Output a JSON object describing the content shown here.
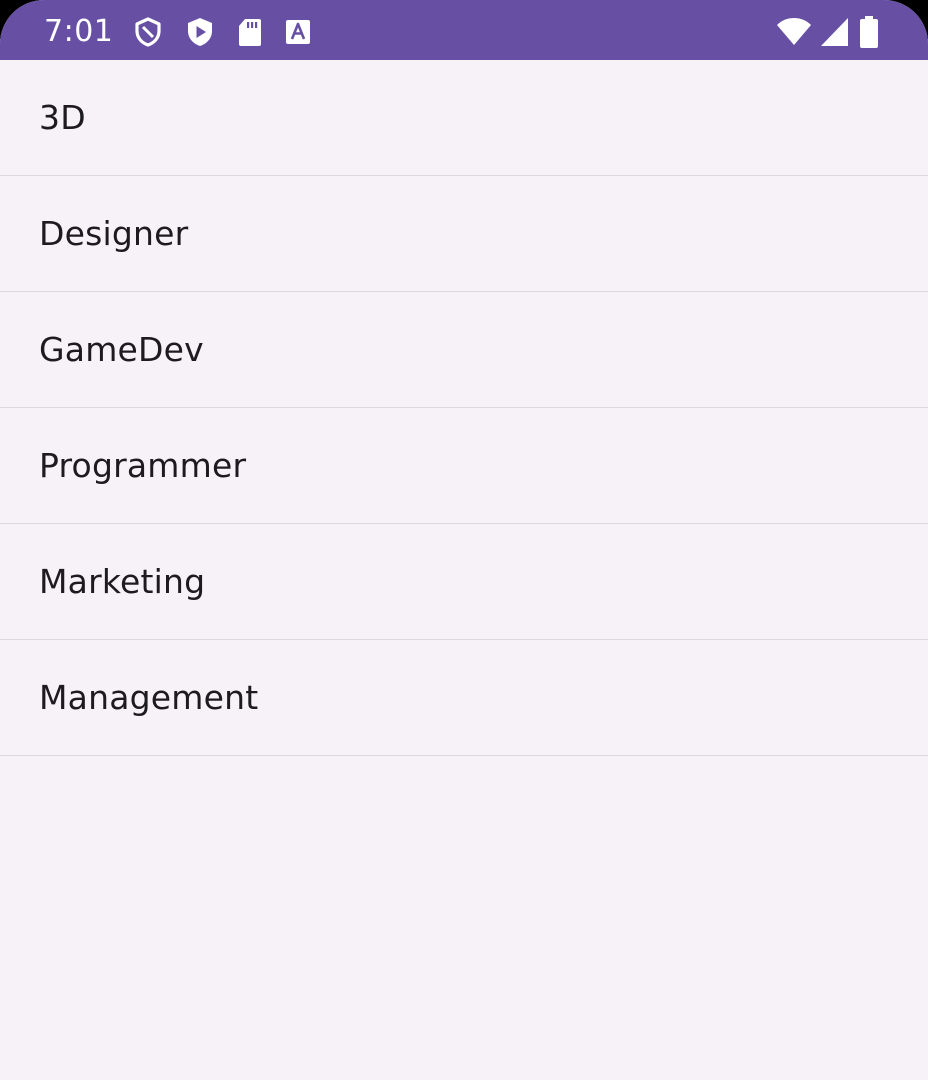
{
  "status_bar": {
    "time": "7:01",
    "left_icons": [
      "shield-outline-icon",
      "play-protect-icon",
      "sd-card-icon",
      "keyboard-a-icon"
    ],
    "right_icons": [
      "wifi-icon",
      "cellular-signal-icon",
      "battery-icon"
    ],
    "color": "#6750a4"
  },
  "list": {
    "items": [
      {
        "label": "3D"
      },
      {
        "label": "Designer"
      },
      {
        "label": "GameDev"
      },
      {
        "label": "Programmer"
      },
      {
        "label": "Marketing"
      },
      {
        "label": "Management"
      }
    ]
  }
}
